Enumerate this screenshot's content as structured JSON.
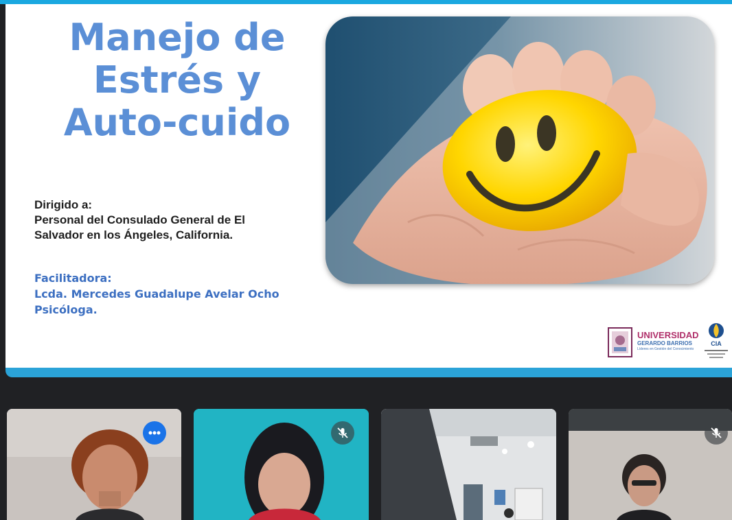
{
  "slide": {
    "title_lines": [
      "Manejo de",
      "Estrés y",
      "Auto-cuido"
    ],
    "audience_lines": [
      "Dirigido a:",
      "Personal del Consulado General de El",
      "Salvador en los Ángeles, California."
    ],
    "facilitator_lines": [
      "Facilitadora:",
      "Lcda. Mercedes Guadalupe Avelar Ocho",
      "Psicóloga."
    ],
    "logo_university": {
      "line1": "UNIVERSIDAD",
      "line2": "GERARDO BARRIOS",
      "tagline": "Líderes en Gestión del Conocimiento"
    },
    "logo_second": {
      "text": "CIA"
    }
  },
  "colors": {
    "title_blue": "#5b8fd6",
    "facilitator_blue": "#3c6fc1",
    "accent_stripe": "#2ba3d8",
    "meet_blue": "#1a73e8"
  },
  "participants": [
    {
      "id": "p1",
      "state": "active-speaker",
      "badge": "more-options-icon",
      "background": "#c9c3bf"
    },
    {
      "id": "p2",
      "state": "muted",
      "badge": "mic-off-icon",
      "background": "#21b4c4"
    },
    {
      "id": "p3",
      "state": "camera-room",
      "badge": "",
      "background": "#d9dde0"
    },
    {
      "id": "p4",
      "state": "muted",
      "badge": "mic-off-icon",
      "background": "#c7c2bd"
    }
  ]
}
